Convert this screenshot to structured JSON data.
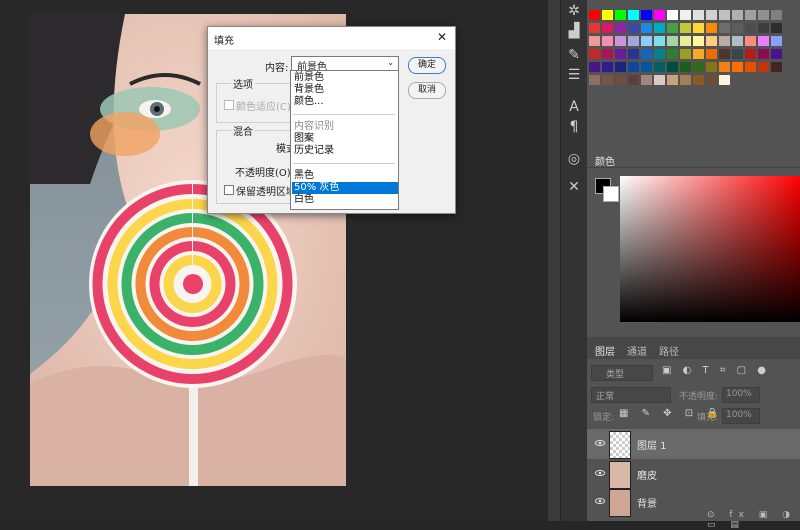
{
  "dialog": {
    "title": "填充",
    "close_icon": "close-icon",
    "content_label": "内容:",
    "content_value": "前景色",
    "options_title": "选项",
    "color_adapt_label": "颜色适应(C)",
    "blend_title": "混合",
    "mode_label": "模式:",
    "opacity_label": "不透明度(O):",
    "preserve_label": "保留透明区域",
    "ok_label": "确定",
    "cancel_label": "取消"
  },
  "dropdown": {
    "items": [
      {
        "label": "前景色"
      },
      {
        "label": "背景色"
      },
      {
        "label": "颜色..."
      },
      {
        "label": "内容识别"
      },
      {
        "label": "图案"
      },
      {
        "label": "历史记录"
      },
      {
        "label": "黑色"
      },
      {
        "label": "50% 灰色"
      },
      {
        "label": "白色"
      }
    ],
    "selected_index": 7
  },
  "color_panel": {
    "tab": "颜色"
  },
  "layers_panel": {
    "tabs": [
      "图层",
      "通道",
      "路径"
    ],
    "search_placeholder": "类型",
    "blend_mode": "正常",
    "opacity_label": "不透明度:",
    "opacity_value": "100%",
    "lock_label": "锁定:",
    "fill_label": "填充:",
    "fill_value": "100%",
    "layers": [
      {
        "name": "图层 1",
        "selected": true
      },
      {
        "name": "磨皮",
        "selected": false
      },
      {
        "name": "背景",
        "selected": false
      }
    ]
  },
  "colors": {
    "accent": "#0078d7",
    "panel_bg": "#535353",
    "dark_bg": "#282828"
  },
  "swatch_rows": [
    [
      "#ff0000",
      "#ffff00",
      "#00ff00",
      "#00ffff",
      "#0000ff",
      "#ff00ff",
      "#ffffff",
      "#f0f0f0",
      "#e0e0e0",
      "#d0d0d0",
      "#c0c0c0",
      "#b0b0b0",
      "#a0a0a0",
      "#909090",
      "#808080"
    ],
    [
      "#e53935",
      "#d81b60",
      "#8e24aa",
      "#3949ab",
      "#1e88e5",
      "#00acc1",
      "#43a047",
      "#c0ca33",
      "#fdd835",
      "#fb8c00",
      "#6d6d6d",
      "#5d5d5d",
      "#4d4d4d",
      "#3d3d3d",
      "#2d2d2d"
    ],
    [
      "#ef9a9a",
      "#f48fb1",
      "#ce93d8",
      "#9fa8da",
      "#90caf9",
      "#80deea",
      "#a5d6a7",
      "#e6ee9c",
      "#fff59d",
      "#ffcc80",
      "#bcaaa4",
      "#b0bec5",
      "#ff8a80",
      "#ea80fc",
      "#8c9eff"
    ],
    [
      "#c62828",
      "#ad1457",
      "#6a1b9a",
      "#283593",
      "#1565c0",
      "#00838f",
      "#2e7d32",
      "#9e9d24",
      "#f9a825",
      "#ef6c00",
      "#4e342e",
      "#37474f",
      "#b71c1c",
      "#880e4f",
      "#4a148c"
    ],
    [
      "#4a148c",
      "#311b92",
      "#1a237e",
      "#0d47a1",
      "#01579b",
      "#006064",
      "#004d40",
      "#1b5e20",
      "#33691e",
      "#827717",
      "#f57f17",
      "#ff6f00",
      "#e65100",
      "#bf360c",
      "#3e2723"
    ],
    [
      "#8d6e63",
      "#795548",
      "#6d4c41",
      "#5d4037",
      "#a1887f",
      "#d7ccc8",
      "#c8a27a",
      "#a67c52",
      "#8b5a2b",
      "#6f4e37",
      "#fff3e0"
    ]
  ]
}
